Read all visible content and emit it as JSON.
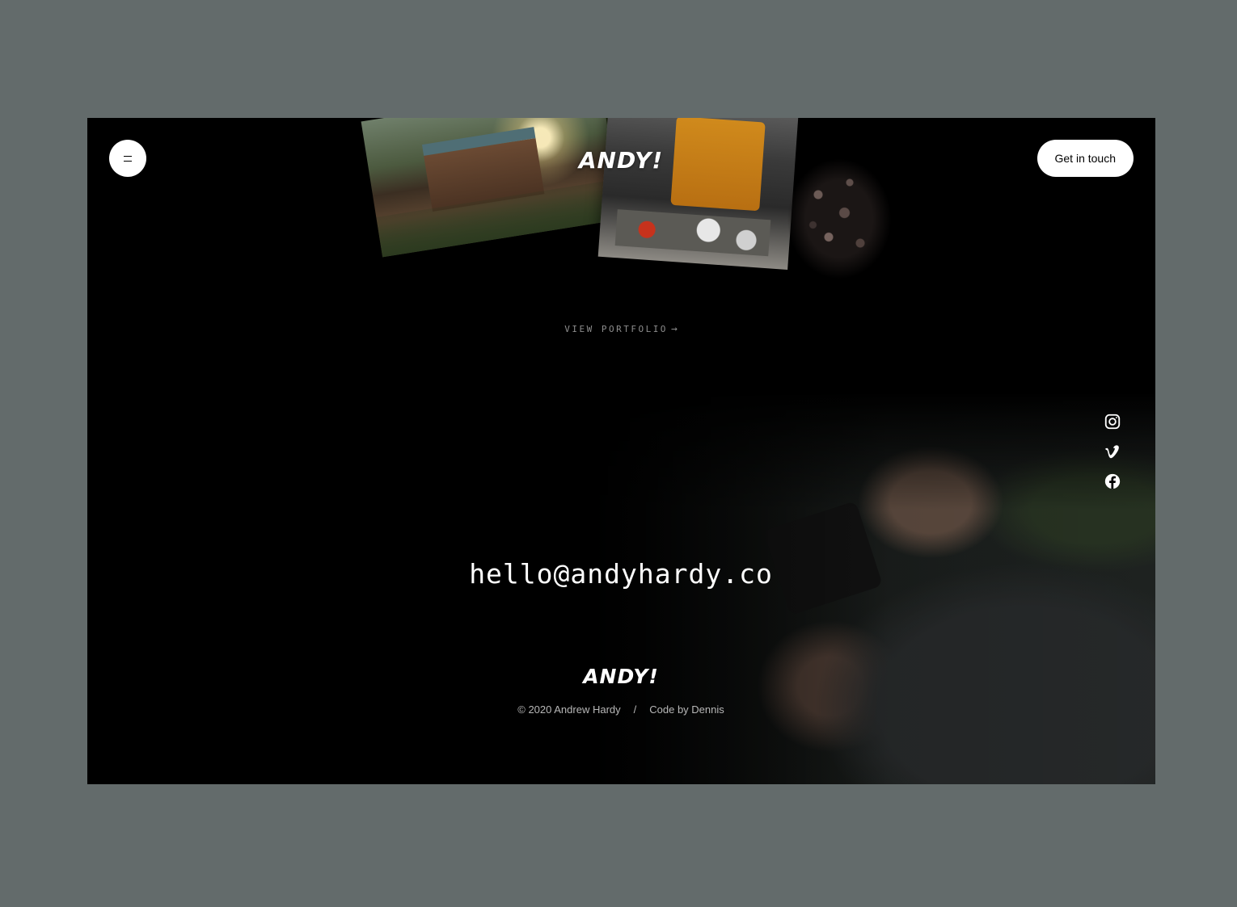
{
  "header": {
    "logo": "ANDY!",
    "cta_label": "Get in touch"
  },
  "hero": {
    "view_portfolio": "VIEW PORTFOLIO",
    "arrow": "→",
    "photos": [
      "cabin-photo",
      "bus-photo",
      "flowers-photo"
    ]
  },
  "social": {
    "items": [
      {
        "icon": "instagram-icon"
      },
      {
        "icon": "vimeo-icon"
      },
      {
        "icon": "facebook-icon"
      }
    ]
  },
  "contact": {
    "email": "hello@andyhardy.co"
  },
  "footer": {
    "logo": "ANDY!",
    "copyright": "© 2020 Andrew Hardy",
    "separator": "/",
    "credit": "Code by Dennis"
  },
  "colors": {
    "outer_background": "#636b6b",
    "page_background": "#000000",
    "text_primary": "#ffffff",
    "text_muted": "#8d8d8d"
  }
}
